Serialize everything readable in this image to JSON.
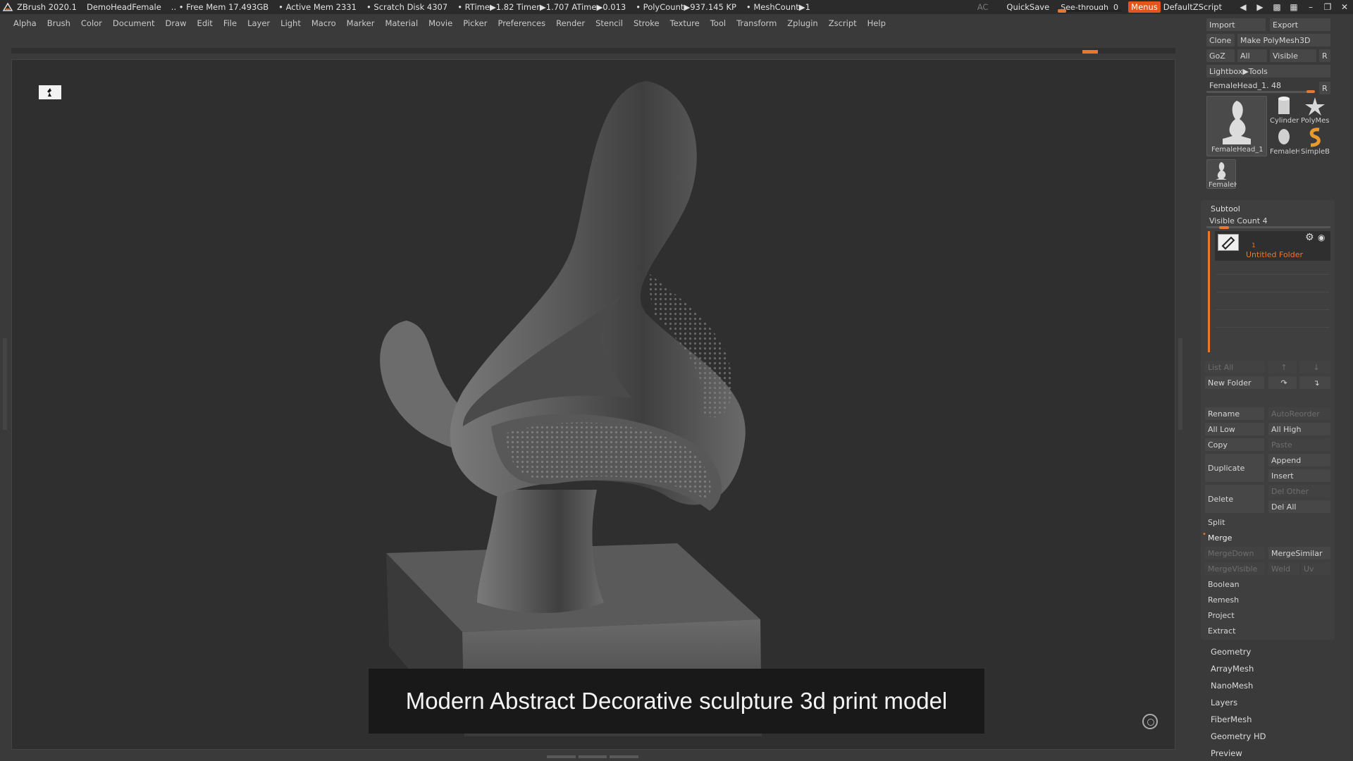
{
  "titlebar": {
    "app": "ZBrush 2020.1",
    "document": "DemoHeadFemale",
    "free_mem": ".. • Free Mem 17.493GB",
    "active_mem": "• Active Mem 2331",
    "scratch": "• Scratch Disk 4307",
    "timers": "•  RTime▶1.82 Timer▶1.707 ATime▶0.013",
    "polycount": "• PolyCount▶937.145 KP",
    "meshcount": "• MeshCount▶1",
    "ac": "AC",
    "quicksave": "QuickSave",
    "see_through": "See-through",
    "see_through_value": "0",
    "menus": "Menus",
    "script": "DefaultZScript"
  },
  "menu": [
    "Alpha",
    "Brush",
    "Color",
    "Document",
    "Draw",
    "Edit",
    "File",
    "Layer",
    "Light",
    "Macro",
    "Marker",
    "Material",
    "Movie",
    "Picker",
    "Preferences",
    "Render",
    "Stencil",
    "Stroke",
    "Texture",
    "Tool",
    "Transform",
    "Zplugin",
    "Zscript",
    "Help"
  ],
  "caption": "Modern Abstract Decorative sculpture 3d print model",
  "tool": {
    "import": "Import",
    "export": "Export",
    "clone": "Clone",
    "make_polymesh": "Make PolyMesh3D",
    "goz": "GoZ",
    "all": "All",
    "visible": "Visible",
    "r": "R",
    "lightbox": "Lightbox▶Tools",
    "current": "FemaleHead_1. 48",
    "thumbs": {
      "main": "FemaleHead_1",
      "cylinder": "Cylinder",
      "polymesh": "PolyMes",
      "female2": "FemaleH",
      "simple": "SimpleB",
      "female3": "FemaleH"
    }
  },
  "subtool": {
    "title": "Subtool",
    "visible_count": "Visible Count 4",
    "folder_num": "1",
    "folder_name": "Untitled Folder",
    "list_all": "List All",
    "new_folder": "New Folder",
    "rename": "Rename",
    "autoreorder": "AutoReorder",
    "all_low": "All Low",
    "all_high": "All High",
    "copy": "Copy",
    "paste": "Paste",
    "duplicate": "Duplicate",
    "append": "Append",
    "insert": "Insert",
    "delete": "Delete",
    "del_other": "Del Other",
    "del_all": "Del All",
    "split": "Split",
    "merge": "Merge",
    "mergedown": "MergeDown",
    "mergesimilar": "MergeSimilar",
    "mergevisible": "MergeVisible",
    "weld": "Weld",
    "uv": "Uv",
    "boolean": "Boolean",
    "remesh": "Remesh",
    "project": "Project",
    "extract": "Extract"
  },
  "groups": [
    "Geometry",
    "ArrayMesh",
    "NanoMesh",
    "Layers",
    "FiberMesh",
    "Geometry HD",
    "Preview"
  ],
  "colors": {
    "accent": "#e8782e",
    "menus_bg": "#e2561c",
    "folder_text": "#e8782e"
  }
}
